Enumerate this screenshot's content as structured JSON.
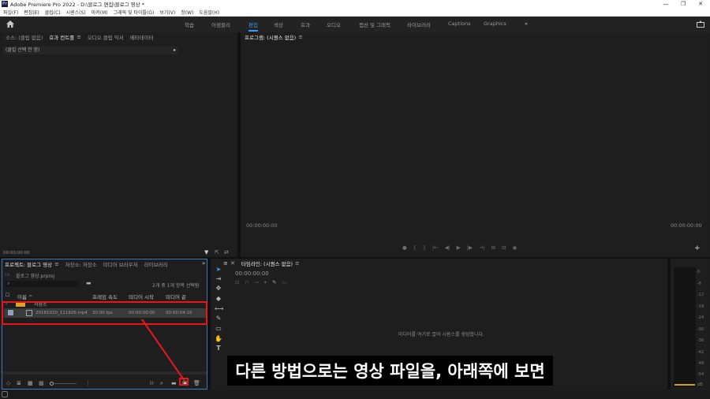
{
  "window": {
    "title": "Adobe Premiere Pro 2022 - D:\\블로그 편집\\블로그 영상 *",
    "logo": "Pr",
    "controls": [
      "—",
      "❐",
      "✕"
    ]
  },
  "menu": [
    "파일(F)",
    "편집(E)",
    "클립(C)",
    "시퀀스(S)",
    "마커(M)",
    "그래픽 및 타이틀(G)",
    "보기(V)",
    "창(W)",
    "도움말(H)"
  ],
  "workspaces": {
    "home_icon": "home-icon",
    "tabs": [
      "학습",
      "어셈블리",
      "편집",
      "색상",
      "효과",
      "오디오",
      "캡션 및 그래픽",
      "라이브러리",
      "Captions",
      "Graphics"
    ],
    "active": "편집",
    "more": "»"
  },
  "source_panel": {
    "tabs": [
      "소스: (클립 없음)",
      "효과 컨트롤",
      "오디오 클립 믹서",
      "메타데이터"
    ],
    "active_tab": "효과 컨트롤",
    "clip_selector": "(클립 선택 안 함)",
    "timecode": "00:00:00:00"
  },
  "program_monitor": {
    "title": "프로그램: (시퀀스 없음)",
    "timecode_left": "00:00:00:00",
    "timecode_right": "00:00:00:00",
    "transport": [
      "●",
      "{",
      "}",
      "|←",
      "◀|",
      "▶",
      "|▶",
      "→|",
      "⊞",
      "⊟",
      "◉"
    ]
  },
  "project_panel": {
    "tabs": [
      "프로젝트: 블로그 영상",
      "저장소: 저장소",
      "미디어 브라우저",
      "라이브러리"
    ],
    "active_tab": "프로젝트: 블로그 영상",
    "file_name": "블로그 영상.prproj",
    "selection_info": "2개 중 1개 항목 선택됨",
    "columns": [
      "이름",
      "프레임 속도",
      "미디어 시작",
      "미디어 끝"
    ],
    "items": [
      {
        "name": "저장소",
        "fps": "",
        "start": "",
        "end": ""
      },
      {
        "name": "20181020_111826.mp4",
        "fps": "30.00 fps",
        "start": "00:00:00:00",
        "end": "00:00:04:10"
      }
    ]
  },
  "timeline_panel": {
    "title": "타임라인: (시퀀스 없음)",
    "timecode": "00:00:00:00",
    "empty_message": "미디어를 여기로 끌어 시퀀스를 생성합니다."
  },
  "audio_meter": {
    "labels": [
      "0",
      "-6",
      "-12",
      "-18",
      "-24",
      "-30",
      "-36",
      "-42",
      "-48",
      "-54",
      "dB"
    ]
  },
  "subtitle": "다른 방법으로는 영상 파일을, 아래쪽에 보면",
  "colors": {
    "accent": "#3a9bf0",
    "highlight": "#e8161b",
    "panel_bg": "#1e1e1e",
    "subtitle_bg": "#000000"
  }
}
